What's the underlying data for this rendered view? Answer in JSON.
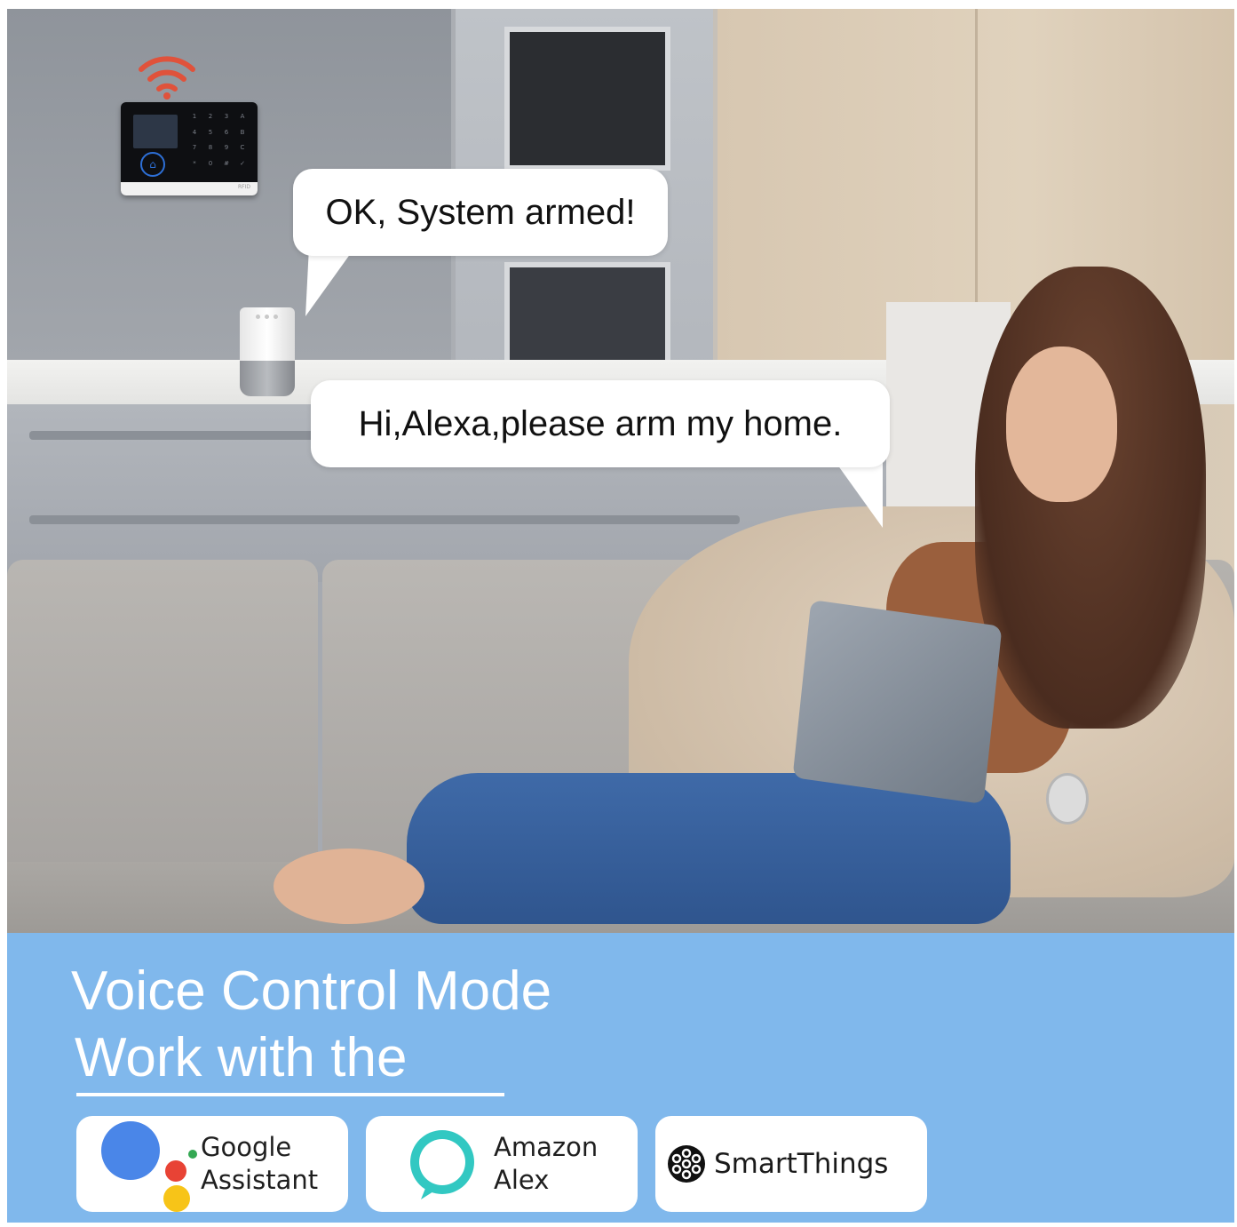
{
  "speech": {
    "system_reply": "OK, System armed!",
    "user_command": "Hi,Alexa,please arm my home."
  },
  "alarm_panel": {
    "keypad": [
      "1",
      "2",
      "3",
      "A",
      "4",
      "5",
      "6",
      "B",
      "7",
      "8",
      "9",
      "C",
      "*",
      "0",
      "#",
      "✓"
    ],
    "badge": "RFID"
  },
  "banner": {
    "headline_line1": "Voice Control Mode",
    "headline_line2": "Work with the",
    "background_color": "#80b8ec"
  },
  "integrations": [
    {
      "name": "google",
      "label_line1": "Google",
      "label_line2": "Assistant",
      "icon": "google-assistant-icon"
    },
    {
      "name": "alexa",
      "label_line1": "Amazon",
      "label_line2": "Alex",
      "icon": "amazon-alexa-icon"
    },
    {
      "name": "smartthings",
      "label": "SmartThings",
      "icon": "smartthings-icon"
    }
  ]
}
